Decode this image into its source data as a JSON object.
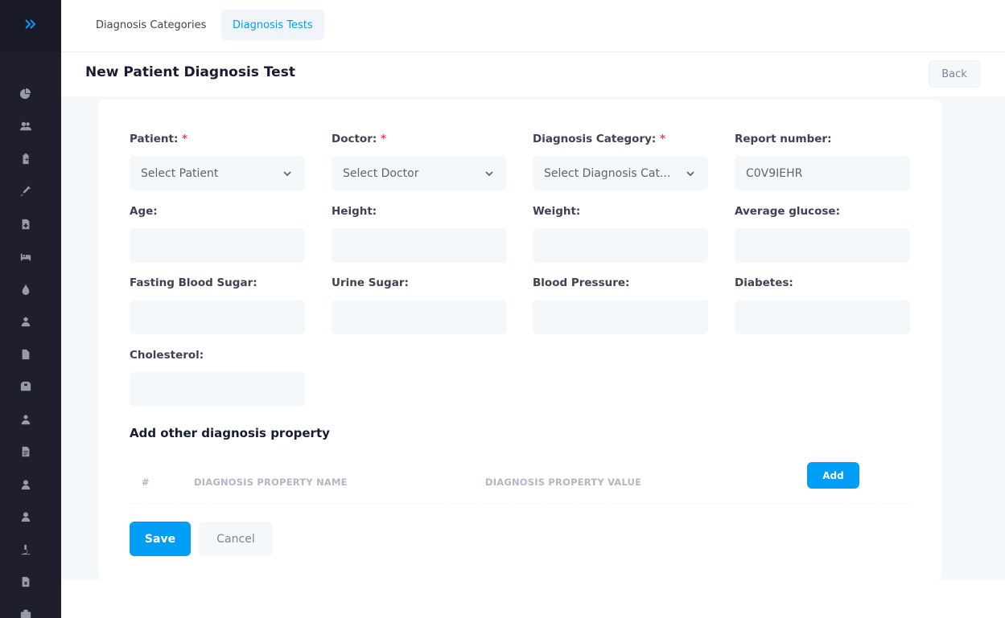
{
  "tabs": [
    {
      "label": "Diagnosis Categories",
      "active": false
    },
    {
      "label": "Diagnosis Tests",
      "active": true
    }
  ],
  "header": {
    "title": "New Patient Diagnosis Test",
    "back_label": "Back"
  },
  "form": {
    "patient": {
      "label": "Patient:",
      "required": "*",
      "value": "Select Patient"
    },
    "doctor": {
      "label": "Doctor:",
      "required": "*",
      "value": "Select Doctor"
    },
    "category": {
      "label": "Diagnosis Category:",
      "required": "*",
      "value": "Select Diagnosis Cat..."
    },
    "report": {
      "label": "Report number:",
      "value": "C0V9IEHR"
    },
    "age": {
      "label": "Age:",
      "value": ""
    },
    "height": {
      "label": "Height:",
      "value": ""
    },
    "weight": {
      "label": "Weight:",
      "value": ""
    },
    "glucose": {
      "label": "Average glucose:",
      "value": ""
    },
    "fasting": {
      "label": "Fasting Blood Sugar:",
      "value": ""
    },
    "urine": {
      "label": "Urine Sugar:",
      "value": ""
    },
    "bp": {
      "label": "Blood Pressure:",
      "value": ""
    },
    "diabetes": {
      "label": "Diabetes:",
      "value": ""
    },
    "cholesterol": {
      "label": "Cholesterol:",
      "value": ""
    }
  },
  "properties": {
    "title": "Add other diagnosis property",
    "columns": [
      "#",
      "DIAGNOSIS PROPERTY NAME",
      "DIAGNOSIS PROPERTY VALUE"
    ],
    "add_label": "Add"
  },
  "actions": {
    "save_label": "Save",
    "cancel_label": "Cancel"
  },
  "colors": {
    "primary": "#009ef7",
    "sidebar": "#1e1e2d",
    "required": "#f1416c"
  },
  "sidebar_icons": [
    "expand-icon",
    "chart-pie-icon",
    "users-icon",
    "clipboard-icon",
    "syringe-icon",
    "file-medical-icon",
    "bed-icon",
    "blood-drop-icon",
    "user-nurse-icon",
    "file-icon",
    "box-icon",
    "user-doctor-icon",
    "file-lines-icon",
    "user-badge-icon",
    "user-icon",
    "microscope-icon",
    "file-invoice-icon"
  ]
}
